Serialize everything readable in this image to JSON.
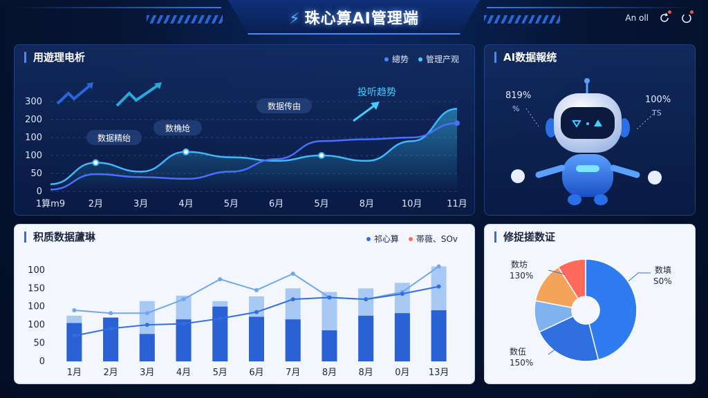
{
  "header": {
    "title": "珠心算AI管理端",
    "right_text": "An oll",
    "icons": [
      "refresh-alert-icon",
      "power-alert-icon"
    ]
  },
  "panels": {
    "top_left": {
      "title": "用遊理电析",
      "legend": [
        "總势",
        "管理产观"
      ],
      "annotations": [
        "数据精绐",
        "数桷炝",
        "数据传由",
        "投听趋势"
      ]
    },
    "top_right": {
      "title": "AI数据報统",
      "left_value": "819%",
      "left_sub": "%",
      "right_value": "100%",
      "right_sub": "TS"
    },
    "bottom_left": {
      "title": "积质数据蘆琳",
      "legend": [
        "祁心算",
        "帯薇、SOv"
      ]
    },
    "bottom_right": {
      "title": "修捉搓数证",
      "labels": [
        {
          "name": "数坊",
          "value": "130%"
        },
        {
          "name": "数填",
          "value": "S0%"
        },
        {
          "name": "数伍",
          "value": "150%"
        }
      ]
    }
  },
  "colors": {
    "accent": "#3f8cff",
    "cyan": "#3fd0ff",
    "red": "#ff6a5a"
  },
  "chart_data": [
    {
      "type": "line",
      "categories": [
        "1算m9",
        "2月",
        "3月",
        "4月",
        "5月",
        "6月",
        "5月",
        "8月",
        "10月",
        "11月"
      ],
      "ylim": [
        0,
        300
      ],
      "yticks": [
        0,
        50,
        100,
        100,
        200,
        300
      ],
      "series": [
        {
          "name": "總势",
          "values": [
            20,
            80,
            55,
            110,
            95,
            85,
            100,
            85,
            140,
            230
          ]
        },
        {
          "name": "管理产观",
          "values": [
            5,
            48,
            40,
            35,
            55,
            90,
            140,
            145,
            150,
            190
          ]
        }
      ]
    },
    {
      "type": "bar",
      "categories": [
        "1月",
        "2月",
        "3月",
        "4月",
        "5月",
        "6月",
        "7月",
        "8月",
        "8月",
        "0月",
        "13月"
      ],
      "yticks": [
        0,
        50,
        100,
        100,
        150,
        100
      ],
      "ylim": [
        0,
        210
      ],
      "series": [
        {
          "name": "祁心算",
          "values": [
            105,
            120,
            75,
            115,
            150,
            122,
            115,
            85,
            125,
            132,
            140
          ]
        },
        {
          "name": "帯薇、SOv",
          "values": [
            125,
            120,
            165,
            180,
            165,
            178,
            200,
            190,
            200,
            215,
            260
          ]
        },
        {
          "name": "line-a",
          "values": [
            140,
            132,
            132,
            170,
            225,
            195,
            240,
            175,
            170,
            190,
            260
          ]
        },
        {
          "name": "line-b",
          "values": [
            70,
            90,
            100,
            103,
            117,
            135,
            170,
            175,
            170,
            185,
            205
          ]
        }
      ]
    },
    {
      "type": "pie",
      "labels": [
        "数填",
        "",
        "",
        "",
        "数坊"
      ],
      "values": [
        46,
        22,
        10,
        13,
        9
      ]
    }
  ]
}
